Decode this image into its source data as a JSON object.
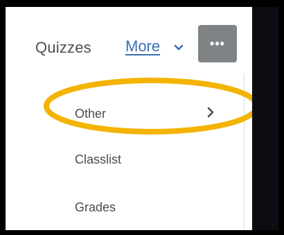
{
  "nav": {
    "quizzes_label": "Quizzes",
    "more_label": "More",
    "dots_label": "•••"
  },
  "menu": {
    "items": [
      {
        "label": "Other",
        "has_submenu": true
      },
      {
        "label": "Classlist",
        "has_submenu": false
      },
      {
        "label": "Grades",
        "has_submenu": false
      }
    ]
  },
  "annotation": {
    "highlight_color": "#F3B400"
  },
  "colors": {
    "link": "#3A6FB3",
    "text": "#494C4E",
    "dots_button_bg": "#808385"
  }
}
